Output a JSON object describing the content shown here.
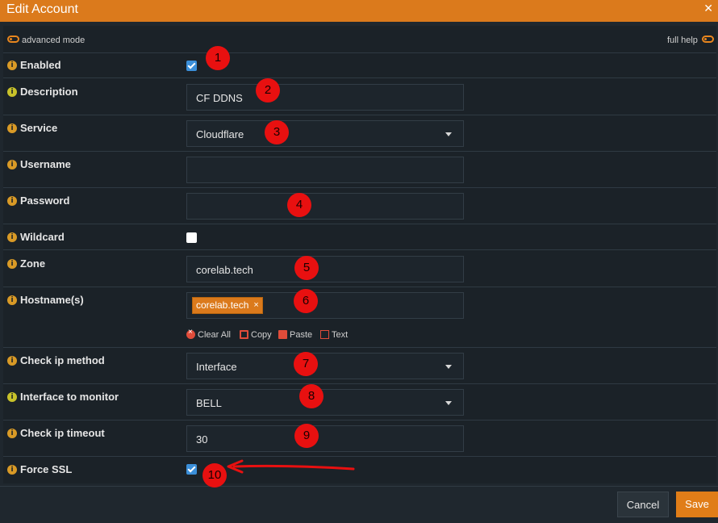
{
  "window": {
    "title": "Edit Account",
    "close_glyph": "✕"
  },
  "modes": {
    "advanced_label": "advanced mode",
    "help_label": "full help"
  },
  "fields": {
    "enabled": {
      "label": "Enabled",
      "checked": true
    },
    "description": {
      "label": "Description",
      "value": "CF DDNS"
    },
    "service": {
      "label": "Service",
      "value": "Cloudflare"
    },
    "username": {
      "label": "Username",
      "value": ""
    },
    "password": {
      "label": "Password",
      "value": ""
    },
    "wildcard": {
      "label": "Wildcard",
      "checked": false
    },
    "zone": {
      "label": "Zone",
      "value": "corelab.tech"
    },
    "hostnames": {
      "label": "Hostname(s)",
      "tags": [
        "corelab.tech"
      ],
      "remove_glyph": "×",
      "tools": {
        "clear": "Clear All",
        "copy": "Copy",
        "paste": "Paste",
        "text": "Text"
      }
    },
    "check_ip_method": {
      "label": "Check ip method",
      "value": "Interface"
    },
    "interface": {
      "label": "Interface to monitor",
      "value": "BELL"
    },
    "timeout": {
      "label": "Check ip timeout",
      "value": "30"
    },
    "force_ssl": {
      "label": "Force SSL",
      "checked": true
    }
  },
  "annotations": [
    "1",
    "2",
    "3",
    "4",
    "5",
    "6",
    "7",
    "8",
    "9",
    "10"
  ],
  "buttons": {
    "cancel": "Cancel",
    "save": "Save"
  },
  "colors": {
    "accent": "#db7a1c",
    "marker": "#e81010",
    "checkbox": "#3b8fd9"
  },
  "icons": {
    "info": "info-circle-icon",
    "toggle": "toggle-icon",
    "close": "close-icon",
    "dropdown": "caret-down-icon",
    "clear": "clear-icon",
    "copy": "copy-icon",
    "paste": "paste-icon",
    "text": "text-icon"
  }
}
